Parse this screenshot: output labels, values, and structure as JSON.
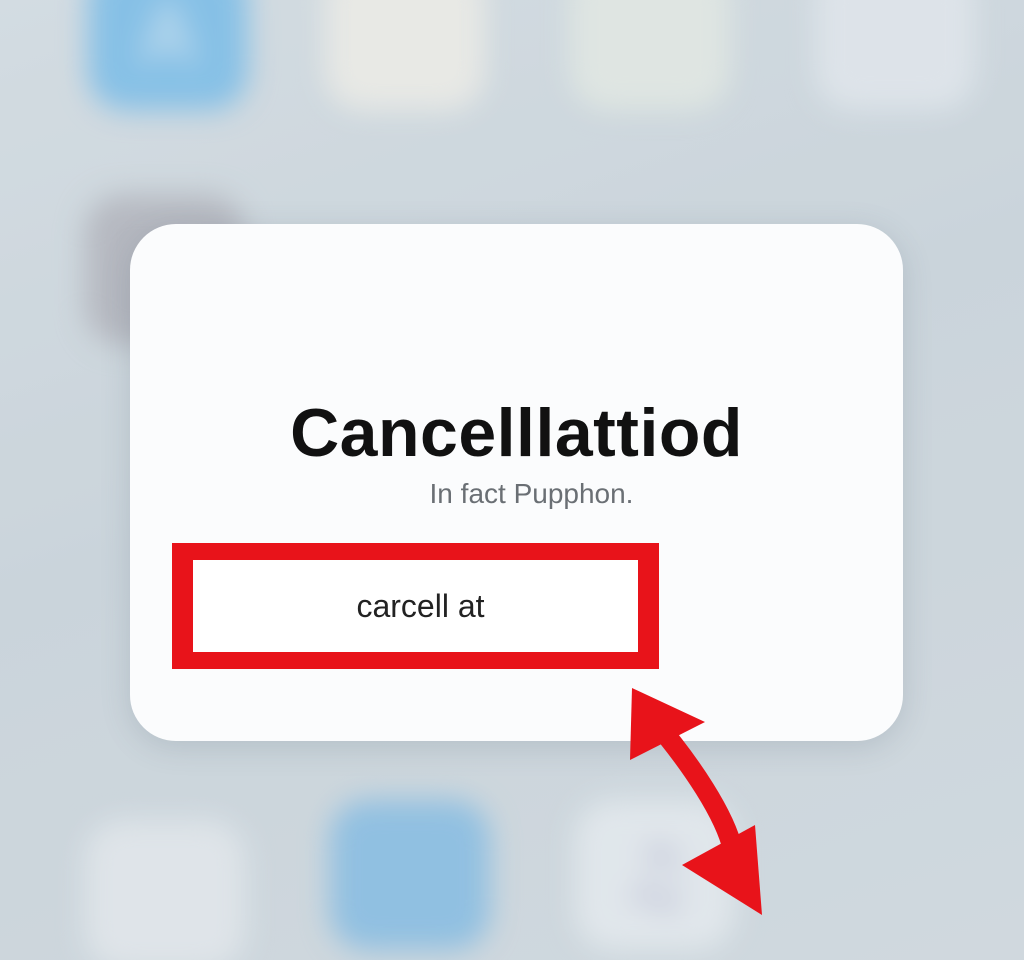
{
  "home_screen": {
    "icons": [
      {
        "name": "app-store-icon",
        "glyph": "A",
        "color": "#5fb3ea"
      },
      {
        "name": "notes-app-icon",
        "glyph": "",
        "color": "#f4f1e8"
      },
      {
        "name": "photos-app-icon",
        "glyph": "",
        "color": "#e6ece3"
      },
      {
        "name": "maps-app-icon",
        "glyph": "",
        "color": "#e4e9ef"
      },
      {
        "name": "settings-app-icon",
        "glyph": "",
        "color": "#a7a7b0"
      },
      {
        "name": "dock-app-icon",
        "glyph": "",
        "color": "#e6eaee"
      },
      {
        "name": "mail-app-icon",
        "glyph": "",
        "color": "#6eb2e2"
      },
      {
        "name": "music-app-icon",
        "glyph": "♫",
        "color": "#e9eef2"
      }
    ]
  },
  "dialog": {
    "title": "Cancelllattiod",
    "subtitle": "In fact Pupphon.",
    "input_value": "carcell at"
  },
  "colors": {
    "highlight": "#e8131a",
    "card": "#fbfcfd",
    "background": "#cdd6dc"
  }
}
